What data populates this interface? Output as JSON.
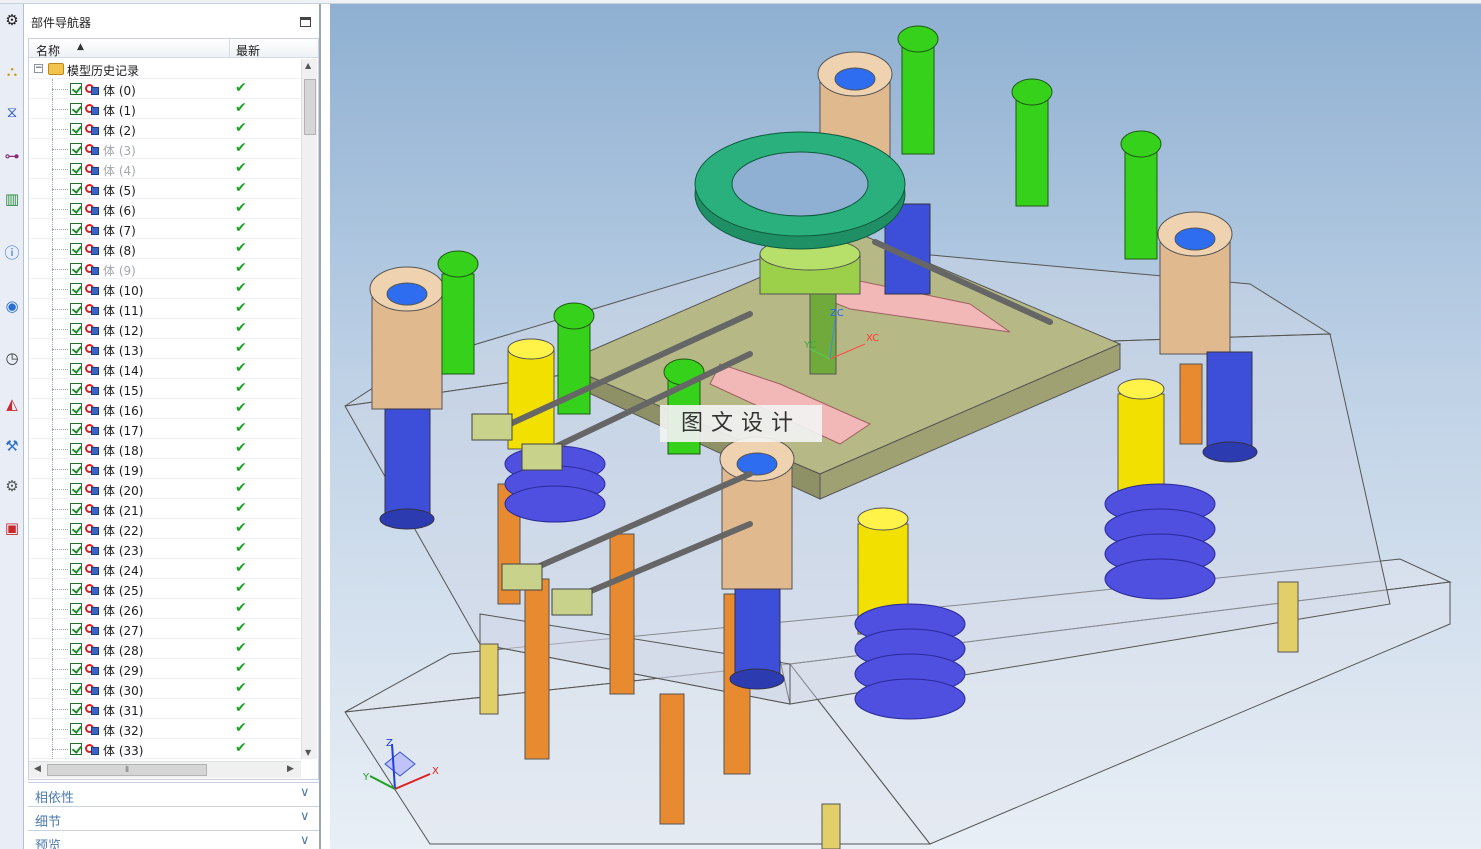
{
  "part_navigator": {
    "title": "部件导航器",
    "columns": {
      "name": "名称",
      "latest": "最新"
    },
    "root_label": "模型历史记录",
    "bodies": [
      {
        "label": "体 (0)",
        "dimmed": false
      },
      {
        "label": "体 (1)",
        "dimmed": false
      },
      {
        "label": "体 (2)",
        "dimmed": false
      },
      {
        "label": "体 (3)",
        "dimmed": true
      },
      {
        "label": "体 (4)",
        "dimmed": true
      },
      {
        "label": "体 (5)",
        "dimmed": false
      },
      {
        "label": "体 (6)",
        "dimmed": false
      },
      {
        "label": "体 (7)",
        "dimmed": false
      },
      {
        "label": "体 (8)",
        "dimmed": false
      },
      {
        "label": "体 (9)",
        "dimmed": true
      },
      {
        "label": "体 (10)",
        "dimmed": false
      },
      {
        "label": "体 (11)",
        "dimmed": false
      },
      {
        "label": "体 (12)",
        "dimmed": false
      },
      {
        "label": "体 (13)",
        "dimmed": false
      },
      {
        "label": "体 (14)",
        "dimmed": false
      },
      {
        "label": "体 (15)",
        "dimmed": false
      },
      {
        "label": "体 (16)",
        "dimmed": false
      },
      {
        "label": "体 (17)",
        "dimmed": false
      },
      {
        "label": "体 (18)",
        "dimmed": false
      },
      {
        "label": "体 (19)",
        "dimmed": false
      },
      {
        "label": "体 (20)",
        "dimmed": false
      },
      {
        "label": "体 (21)",
        "dimmed": false
      },
      {
        "label": "体 (22)",
        "dimmed": false
      },
      {
        "label": "体 (23)",
        "dimmed": false
      },
      {
        "label": "体 (24)",
        "dimmed": false
      },
      {
        "label": "体 (25)",
        "dimmed": false
      },
      {
        "label": "体 (26)",
        "dimmed": false
      },
      {
        "label": "体 (27)",
        "dimmed": false
      },
      {
        "label": "体 (28)",
        "dimmed": false
      },
      {
        "label": "体 (29)",
        "dimmed": false
      },
      {
        "label": "体 (30)",
        "dimmed": false
      },
      {
        "label": "体 (31)",
        "dimmed": false
      },
      {
        "label": "体 (32)",
        "dimmed": false
      },
      {
        "label": "体 (33)",
        "dimmed": false
      }
    ],
    "sections": [
      {
        "title": "相依性"
      },
      {
        "title": "细节"
      },
      {
        "title": "预览"
      }
    ]
  },
  "viewport": {
    "watermark": "图文设计",
    "wcs_labels": {
      "zc": "ZC",
      "yc": "YC",
      "xc": "XC"
    },
    "triad_labels": {
      "x": "X",
      "y": "Y",
      "z": "Z"
    }
  },
  "icons": {
    "resource_bar": [
      "gear-icon",
      "assembly-navigator-icon",
      "constraint-navigator-icon",
      "part-navigator-icon",
      "reuse-library-icon",
      "hd3d-tools-icon",
      "web-browser-icon",
      "history-icon",
      "system-materials-icon",
      "process-studio-icon",
      "manufacturing-wizards-icon",
      "roles-icon"
    ]
  },
  "colors": {
    "viewport_top": "#8fb0d2",
    "viewport_bottom": "#e9eff6",
    "section_title": "#4d79b0",
    "check_green": "#1aa524"
  }
}
